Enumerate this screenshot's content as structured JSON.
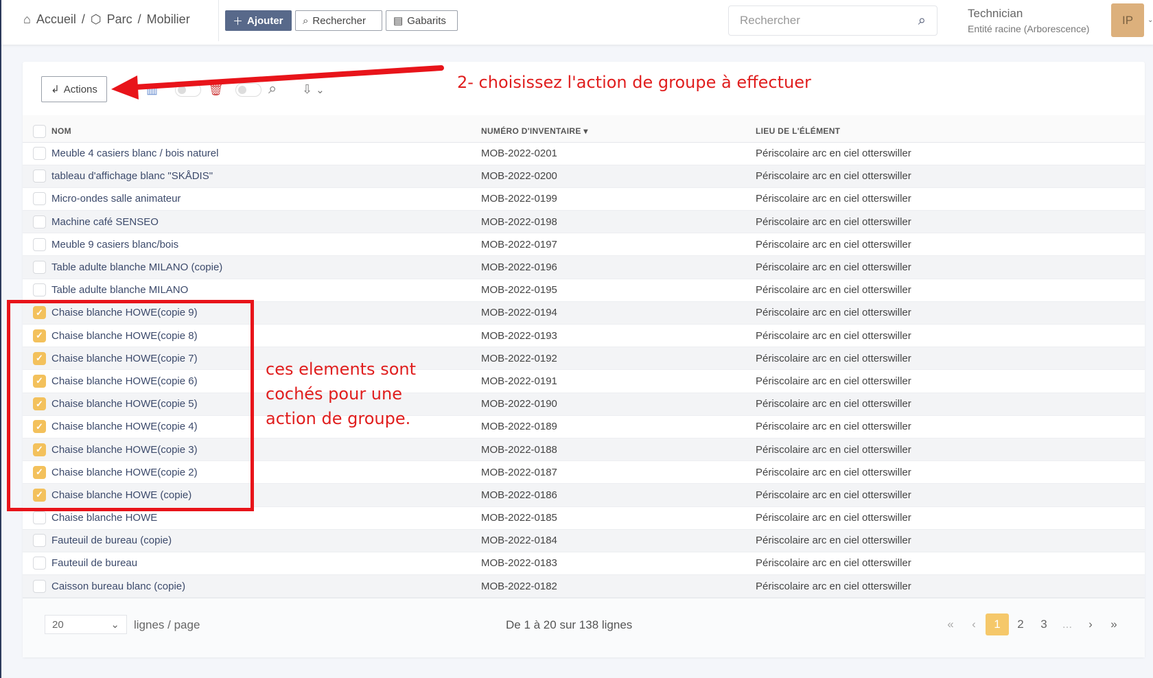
{
  "breadcrumb": [
    {
      "label": "Accueil",
      "icon": "home-icon"
    },
    {
      "label": "Parc",
      "icon": "cube-icon"
    },
    {
      "label": "Mobilier"
    }
  ],
  "header": {
    "add_label": "Ajouter",
    "search_label": "Rechercher",
    "templates_label": "Gabarits",
    "search_placeholder": "Rechercher",
    "user_role": "Technician",
    "user_entity": "Entité racine (Arborescence)",
    "avatar_initials": "IP"
  },
  "toolbar": {
    "actions_label": "Actions"
  },
  "table": {
    "columns": [
      "NOM",
      "NUMÉRO D'INVENTAIRE",
      "LIEU DE L'ÉLÉMENT"
    ],
    "rows": [
      {
        "name": "Meuble 4 casiers blanc / bois naturel",
        "inv": "MOB-2022-0201",
        "loc": "Périscolaire arc en ciel otterswiller",
        "checked": false
      },
      {
        "name": "tableau d'affichage blanc \"SKÅDIS\"",
        "inv": "MOB-2022-0200",
        "loc": "Périscolaire arc en ciel otterswiller",
        "checked": false
      },
      {
        "name": "Micro-ondes salle animateur",
        "inv": "MOB-2022-0199",
        "loc": "Périscolaire arc en ciel otterswiller",
        "checked": false
      },
      {
        "name": "Machine café SENSEO",
        "inv": "MOB-2022-0198",
        "loc": "Périscolaire arc en ciel otterswiller",
        "checked": false
      },
      {
        "name": "Meuble 9 casiers blanc/bois",
        "inv": "MOB-2022-0197",
        "loc": "Périscolaire arc en ciel otterswiller",
        "checked": false
      },
      {
        "name": "Table adulte blanche MILANO (copie)",
        "inv": "MOB-2022-0196",
        "loc": "Périscolaire arc en ciel otterswiller",
        "checked": false
      },
      {
        "name": "Table adulte blanche MILANO",
        "inv": "MOB-2022-0195",
        "loc": "Périscolaire arc en ciel otterswiller",
        "checked": false
      },
      {
        "name": "Chaise blanche HOWE(copie 9)",
        "inv": "MOB-2022-0194",
        "loc": "Périscolaire arc en ciel otterswiller",
        "checked": true
      },
      {
        "name": "Chaise blanche HOWE(copie 8)",
        "inv": "MOB-2022-0193",
        "loc": "Périscolaire arc en ciel otterswiller",
        "checked": true
      },
      {
        "name": "Chaise blanche HOWE(copie 7)",
        "inv": "MOB-2022-0192",
        "loc": "Périscolaire arc en ciel otterswiller",
        "checked": true
      },
      {
        "name": "Chaise blanche HOWE(copie 6)",
        "inv": "MOB-2022-0191",
        "loc": "Périscolaire arc en ciel otterswiller",
        "checked": true
      },
      {
        "name": "Chaise blanche HOWE(copie 5)",
        "inv": "MOB-2022-0190",
        "loc": "Périscolaire arc en ciel otterswiller",
        "checked": true
      },
      {
        "name": "Chaise blanche HOWE(copie 4)",
        "inv": "MOB-2022-0189",
        "loc": "Périscolaire arc en ciel otterswiller",
        "checked": true
      },
      {
        "name": "Chaise blanche HOWE(copie 3)",
        "inv": "MOB-2022-0188",
        "loc": "Périscolaire arc en ciel otterswiller",
        "checked": true
      },
      {
        "name": "Chaise blanche HOWE(copie 2)",
        "inv": "MOB-2022-0187",
        "loc": "Périscolaire arc en ciel otterswiller",
        "checked": true
      },
      {
        "name": "Chaise blanche HOWE (copie)",
        "inv": "MOB-2022-0186",
        "loc": "Périscolaire arc en ciel otterswiller",
        "checked": true
      },
      {
        "name": "Chaise blanche HOWE",
        "inv": "MOB-2022-0185",
        "loc": "Périscolaire arc en ciel otterswiller",
        "checked": false
      },
      {
        "name": "Fauteuil de bureau (copie)",
        "inv": "MOB-2022-0184",
        "loc": "Périscolaire arc en ciel otterswiller",
        "checked": false
      },
      {
        "name": "Fauteuil de bureau",
        "inv": "MOB-2022-0183",
        "loc": "Périscolaire arc en ciel otterswiller",
        "checked": false
      },
      {
        "name": "Caisson bureau blanc (copie)",
        "inv": "MOB-2022-0182",
        "loc": "Périscolaire arc en ciel otterswiller",
        "checked": false
      }
    ]
  },
  "footer": {
    "page_size": "20",
    "per_page_label": "lignes / page",
    "count_label": "De 1 à 20 sur 138 lignes",
    "pages": [
      "1",
      "2",
      "3",
      "..."
    ],
    "current_page": "1"
  },
  "annotations": {
    "step2": "2- choisissez l'action de groupe à effectuer",
    "checked_note_lines": [
      "ces elements sont",
      "cochés pour une",
      "action de groupe."
    ]
  },
  "colors": {
    "accent": "#f3c15c",
    "primary": "#58698a",
    "annotation": "#e01e1e"
  }
}
